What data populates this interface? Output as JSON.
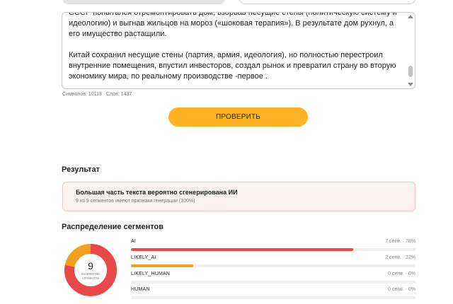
{
  "colors": {
    "accent": "#fdb322",
    "ai": "#e84848",
    "likely_ai": "#f0a020",
    "track": "#efefef"
  },
  "editor": {
    "cut_line": "СССР попытался отремонтировать дом, взорвав несущие стены (политическую систему и",
    "paragraph1": "идеологию) и выгнав жильцов на мороз («шоковая терапия»). В результате дом рухнул, а его имущество растащили.",
    "paragraph2": "Китай сохранил несущие стены (партия, армия, идеология), но полностью перестроил внутренние помещения, впустил инвесторов, создал рынок и превратил страну во вторую экономику мира, по реальному производстве -первое ."
  },
  "counter": "Символов: 10113 · Слов: 1437",
  "check_button": "ПРОВЕРИТЬ",
  "result": {
    "title": "Результат",
    "verdict": "Большая часть текста вероятно сгенерирована ИИ",
    "detail": "9 из 9 сегментов имеют признаки генерации (100%)"
  },
  "distribution": {
    "title": "Распределение сегментов",
    "total": "9",
    "total_caption_line1": "количество",
    "total_caption_line2": "сегментов",
    "rows": [
      {
        "name": "AI",
        "meta": "7 сегм. · 78%",
        "fraction": 0.78
      },
      {
        "name": "LIKELY_AI",
        "meta": "2 сегм. · 22%",
        "fraction": 0.22
      },
      {
        "name": "LIKELY_HUMAN",
        "meta": "0 сегм. · 0%",
        "fraction": 0
      },
      {
        "name": "HUMAN",
        "meta": "0 сегм. · 0%",
        "fraction": 0
      }
    ]
  }
}
